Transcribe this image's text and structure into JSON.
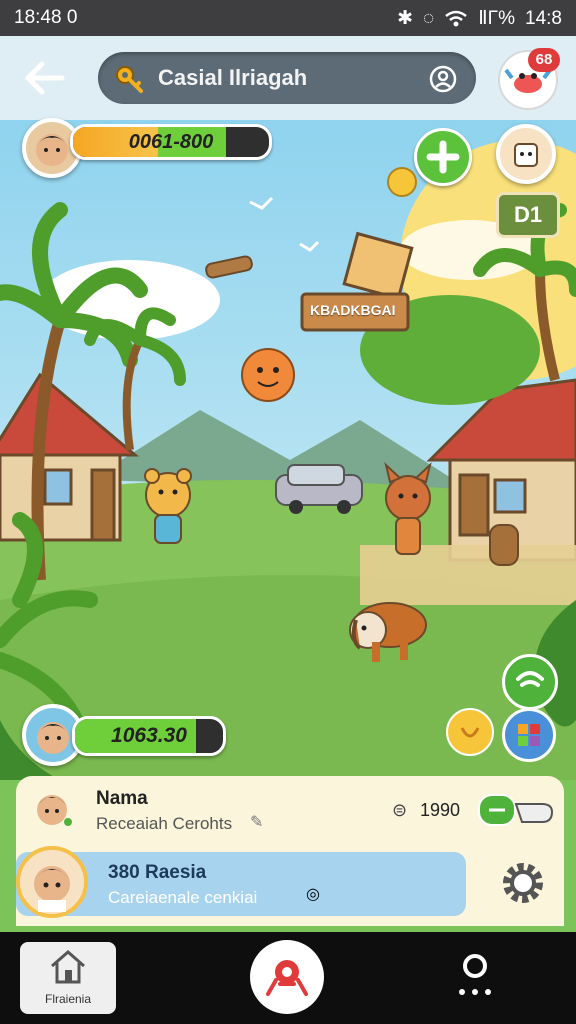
{
  "status_bar": {
    "time": "18:48 0",
    "battery": "ⅡΓ%",
    "clock_right": "14:8"
  },
  "header": {
    "title": "Casial Ilriagah",
    "notification_count": "68"
  },
  "hud": {
    "top_bar_text": "0061-800",
    "top_bar_fill": 0.78,
    "bottom_bar_text": "1063.30",
    "bottom_bar_fill": 0.82,
    "side_counter": "D1"
  },
  "scene": {
    "sign_text": "KBADKBGAI"
  },
  "card_user": {
    "name": "Nama",
    "subtitle": "Receaiah Cerohts",
    "count": "1990"
  },
  "card_player": {
    "title": "380 Raesia",
    "subtitle": "Careiaenale cenkiai"
  },
  "nav": {
    "home_label": "Flraienia"
  },
  "colors": {
    "accent": "#e03b3b",
    "bar_green": "#6fcf3b",
    "bar_orange": "#f5a623"
  },
  "icons": [
    "back-arrow-icon",
    "key-icon",
    "user-search-icon",
    "plus-icon",
    "gear-icon",
    "home-icon",
    "map-pin-icon",
    "person-icon"
  ]
}
